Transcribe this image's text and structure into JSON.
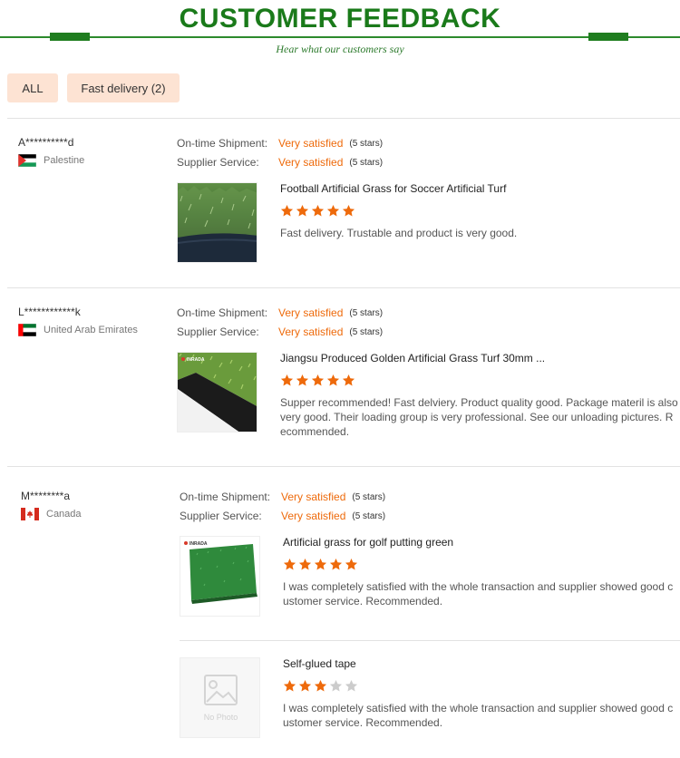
{
  "header": {
    "title": "CUSTOMER FEEDBACK",
    "subtitle": "Hear what our customers say"
  },
  "filters": [
    {
      "label": "ALL"
    },
    {
      "label": "Fast delivery (2)"
    }
  ],
  "rating_labels": {
    "shipment": "On-time Shipment:",
    "service": "Supplier Service:"
  },
  "reviews": [
    {
      "user": "A**********d",
      "country": "Palestine",
      "shipment": {
        "value": "Very satisfied",
        "stars_text": "(5 stars)"
      },
      "service": {
        "value": "Very satisfied",
        "stars_text": "(5 stars)"
      },
      "products": [
        {
          "title": "Football Artificial Grass for Soccer Artificial Turf",
          "rating": 5,
          "comment": "Fast delivery. Trustable and product is very good."
        }
      ]
    },
    {
      "user": "L************k",
      "country": "United Arab Emirates",
      "shipment": {
        "value": "Very satisfied",
        "stars_text": "(5 stars)"
      },
      "service": {
        "value": "Very satisfied",
        "stars_text": "(5 stars)"
      },
      "products": [
        {
          "title": "Jiangsu Produced Golden Artificial Grass Turf 30mm ...",
          "rating": 5,
          "thumb_brand": "INRADA",
          "comment": "Supper recommended! Fast delviery. Product quality good. Package materil is also very good. Their loading group is very professional. See our unloading pictures. Recommended."
        }
      ]
    },
    {
      "user": "M********a",
      "country": "Canada",
      "shipment": {
        "value": "Very satisfied",
        "stars_text": "(5 stars)"
      },
      "service": {
        "value": "Very satisfied",
        "stars_text": "(5 stars)"
      },
      "products": [
        {
          "title": "Artificial grass for golf putting green",
          "rating": 5,
          "thumb_brand": "INRADA",
          "comment": "I was completely satisfied with the whole transaction and supplier showed good customer service. Recommended."
        },
        {
          "title": "Self-glued tape",
          "rating": 3,
          "thumb_placeholder": "No Photo",
          "comment": "I was completely satisfied with the whole transaction and supplier showed good customer service. Recommended."
        }
      ]
    }
  ],
  "colors": {
    "brand_green": "#1a7a1a",
    "accent_orange": "#ee6a0b",
    "filter_bg": "#fde3d3",
    "star_empty": "#cccccc"
  },
  "icons": [
    "star-icon",
    "flag-palestine-icon",
    "flag-uae-icon",
    "flag-canada-icon",
    "no-photo-icon"
  ]
}
